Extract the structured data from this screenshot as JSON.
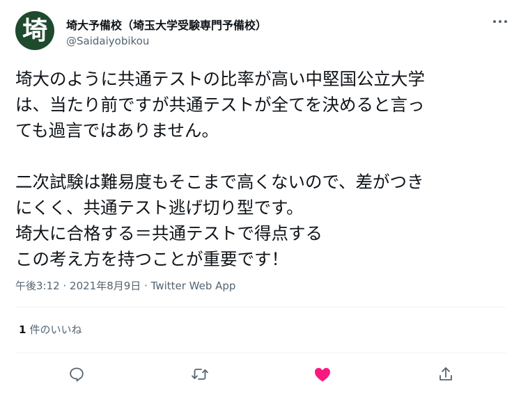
{
  "author": {
    "avatar_char": "埼",
    "display_name": "埼大予備校（埼玉大学受験専門予備校）",
    "handle": "@Saidaiyobikou"
  },
  "tweet": {
    "lines": [
      "埼大のように共通テストの比率が高い中堅国公立大学",
      "は、当たり前ですが共通テストが全てを決めると言っ",
      "ても過言ではありません。",
      "",
      "二次試験は難易度もそこまで高くないので、差がつき",
      "にくく、共通テスト逃げ切り型です。",
      "埼大に合格する＝共通テストで得点する",
      "この考え方を持つことが重要です！"
    ]
  },
  "meta": {
    "time": "午後3:12",
    "separator1": "·",
    "date": "2021年8月9日",
    "separator2": "·",
    "source": "Twitter Web App"
  },
  "engagement": {
    "like_count": "1",
    "like_label": "件のいいね"
  },
  "actions": {
    "reply_icon": "reply-icon",
    "retweet_icon": "retweet-icon",
    "like_icon": "heart-icon",
    "share_icon": "share-icon",
    "like_color": "#f91880",
    "icon_color": "#536471"
  }
}
